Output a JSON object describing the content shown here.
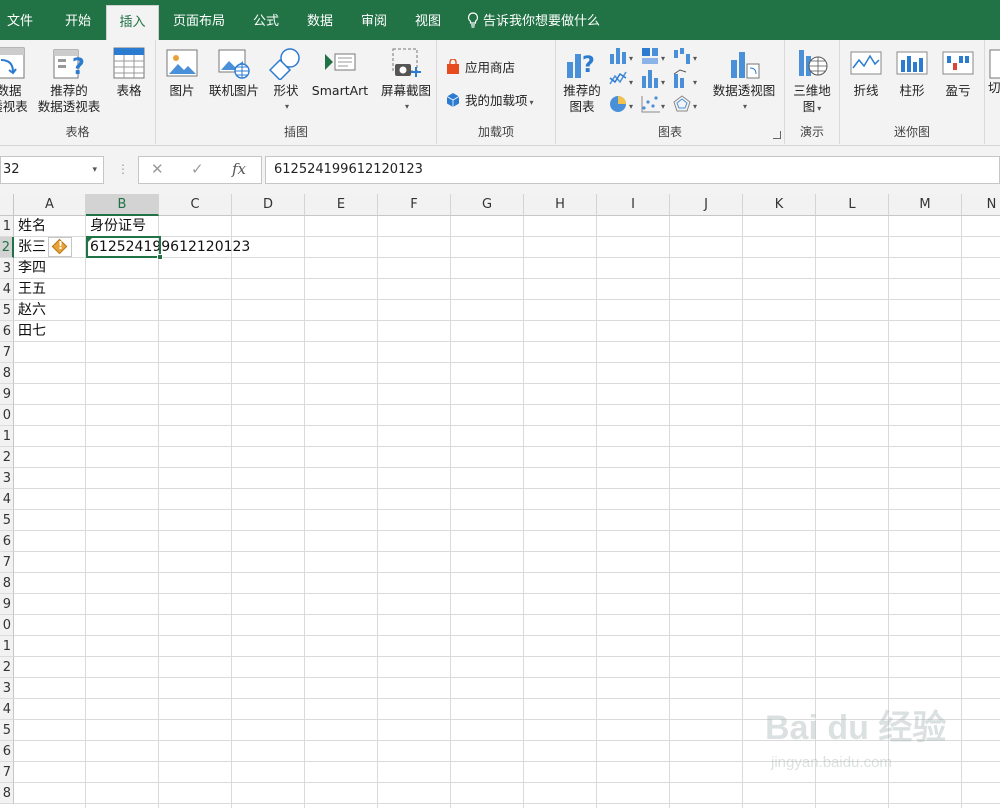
{
  "menu": {
    "tabs": [
      "文件",
      "开始",
      "插入",
      "页面布局",
      "公式",
      "数据",
      "审阅",
      "视图"
    ],
    "active": "插入",
    "tell_me": "告诉我你想要做什么"
  },
  "ribbon": {
    "tables": {
      "label": "表格",
      "pivot": [
        "数据",
        "透视表"
      ],
      "recommended_pivot": [
        "推荐的",
        "数据透视表"
      ],
      "table": "表格"
    },
    "illustrations": {
      "label": "插图",
      "picture": "图片",
      "online_picture": "联机图片",
      "shapes": "形状",
      "smartart": "SmartArt",
      "screenshot": "屏幕截图"
    },
    "addins": {
      "label": "加载项",
      "store": "应用商店",
      "my_addins": "我的加载项"
    },
    "charts": {
      "label": "图表",
      "recommended": [
        "推荐的",
        "图表"
      ],
      "pivot_chart": "数据透视图"
    },
    "tours": {
      "label": "演示",
      "map3d": [
        "三维地",
        "图"
      ]
    },
    "sparklines": {
      "label": "迷你图",
      "line": "折线",
      "column": "柱形",
      "winloss": "盈亏",
      "slicer": "切"
    }
  },
  "formula_bar": {
    "name_box": "32",
    "value": "612524199612120123"
  },
  "sheet": {
    "columns": [
      "A",
      "B",
      "C",
      "D",
      "E",
      "F",
      "G",
      "H",
      "I",
      "J",
      "K",
      "L",
      "M",
      "N"
    ],
    "rows": [
      "1",
      "2",
      "3",
      "4",
      "5",
      "6",
      "7",
      "8",
      "9",
      "0",
      "1",
      "2",
      "3",
      "4",
      "5",
      "6",
      "7",
      "8",
      "9",
      "0",
      "1",
      "2",
      "3",
      "4",
      "5",
      "6",
      "7",
      "8"
    ],
    "cells": {
      "a1": "姓名",
      "b1": "身份证号",
      "a2": "张三",
      "b2": "612524199612120123",
      "a3": "李四",
      "a4": "王五",
      "a5": "赵六",
      "a6": "田七"
    },
    "selected_col": "B",
    "selected_row": "2"
  },
  "watermark": {
    "brand": "Bai du 经验",
    "url": "jingyan.baidu.com"
  },
  "colors": {
    "excel_green": "#217346",
    "ribbon_bg": "#f3f3f3"
  }
}
